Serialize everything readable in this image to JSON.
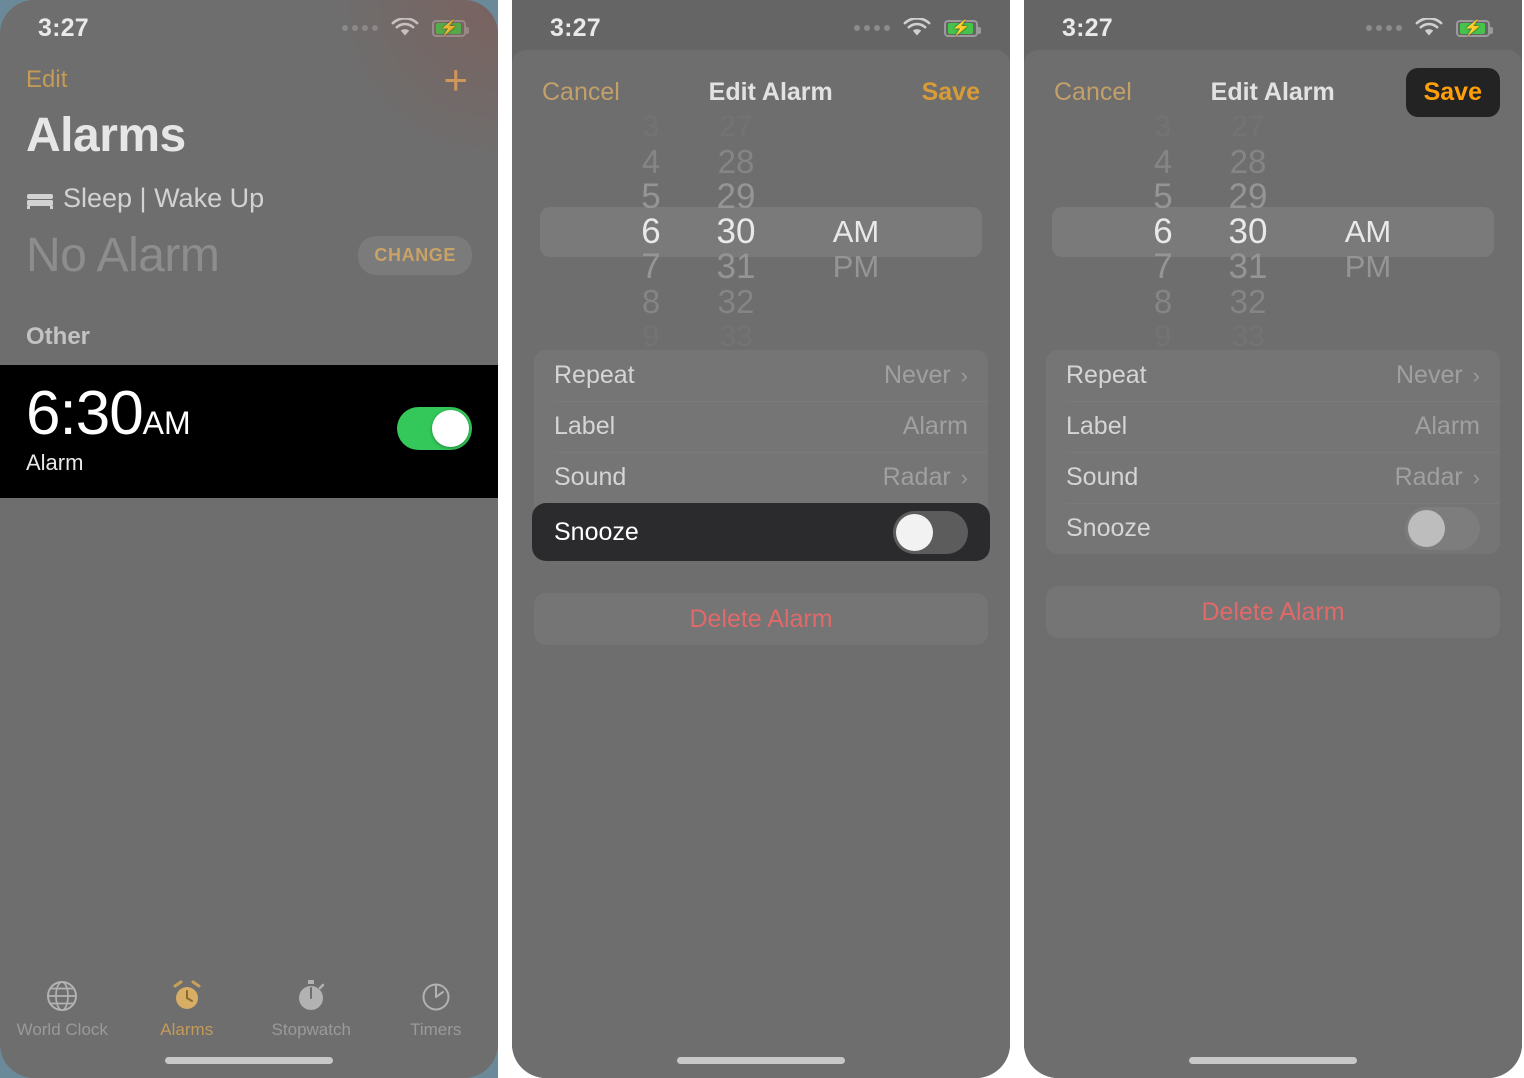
{
  "status_bar": {
    "time": "3:27",
    "signal_icon": "signal-dots-icon",
    "wifi_icon": "wifi-icon",
    "battery_icon": "battery-charging-icon"
  },
  "panel1": {
    "nav": {
      "edit_label": "Edit",
      "add_icon": "plus-icon"
    },
    "title": "Alarms",
    "sleep_section": {
      "icon": "bed-icon",
      "label": "Sleep | Wake Up",
      "value": "No Alarm",
      "change_label": "CHANGE"
    },
    "other_section_header": "Other",
    "alarm": {
      "time": "6:30",
      "period": "AM",
      "label": "Alarm",
      "enabled": true,
      "toggle_color": "#34c759"
    },
    "tabs": [
      {
        "label": "World Clock",
        "icon": "globe-icon",
        "active": false
      },
      {
        "label": "Alarms",
        "icon": "alarm-clock-icon",
        "active": true
      },
      {
        "label": "Stopwatch",
        "icon": "stopwatch-icon",
        "active": false
      },
      {
        "label": "Timers",
        "icon": "timer-icon",
        "active": false
      }
    ]
  },
  "panel2": {
    "nav": {
      "cancel_label": "Cancel",
      "title": "Edit Alarm",
      "save_label": "Save",
      "save_highlighted": false
    },
    "picker": {
      "hours": [
        "3",
        "4",
        "5",
        "6",
        "7",
        "8",
        "9"
      ],
      "minutes": [
        "27",
        "28",
        "29",
        "30",
        "31",
        "32",
        "33"
      ],
      "periods": [
        "AM",
        "PM"
      ],
      "selected_hour": "6",
      "selected_minute": "30",
      "selected_period": "AM"
    },
    "settings": [
      {
        "label": "Repeat",
        "value": "Never",
        "chevron": "chevron-right-icon",
        "type": "link",
        "highlighted": false
      },
      {
        "label": "Label",
        "value": "Alarm",
        "type": "value",
        "highlighted": false
      },
      {
        "label": "Sound",
        "value": "Radar",
        "chevron": "chevron-right-icon",
        "type": "link",
        "highlighted": false
      },
      {
        "label": "Snooze",
        "value": "",
        "type": "toggle",
        "enabled": false,
        "highlighted": true
      }
    ],
    "delete_label": "Delete Alarm",
    "delete_color": "#e06a6a"
  },
  "panel3": {
    "nav": {
      "cancel_label": "Cancel",
      "title": "Edit Alarm",
      "save_label": "Save",
      "save_highlighted": true,
      "save_accent": "#ff9f0a"
    },
    "picker": {
      "hours": [
        "3",
        "4",
        "5",
        "6",
        "7",
        "8",
        "9"
      ],
      "minutes": [
        "27",
        "28",
        "29",
        "30",
        "31",
        "32",
        "33"
      ],
      "periods": [
        "AM",
        "PM"
      ],
      "selected_hour": "6",
      "selected_minute": "30",
      "selected_period": "AM"
    },
    "settings": [
      {
        "label": "Repeat",
        "value": "Never",
        "chevron": "chevron-right-icon",
        "type": "link",
        "highlighted": false
      },
      {
        "label": "Label",
        "value": "Alarm",
        "type": "value",
        "highlighted": false
      },
      {
        "label": "Sound",
        "value": "Radar",
        "chevron": "chevron-right-icon",
        "type": "link",
        "highlighted": false
      },
      {
        "label": "Snooze",
        "value": "",
        "type": "toggle",
        "enabled": false,
        "highlighted": false
      }
    ],
    "delete_label": "Delete Alarm",
    "delete_color": "#e06a6a"
  }
}
